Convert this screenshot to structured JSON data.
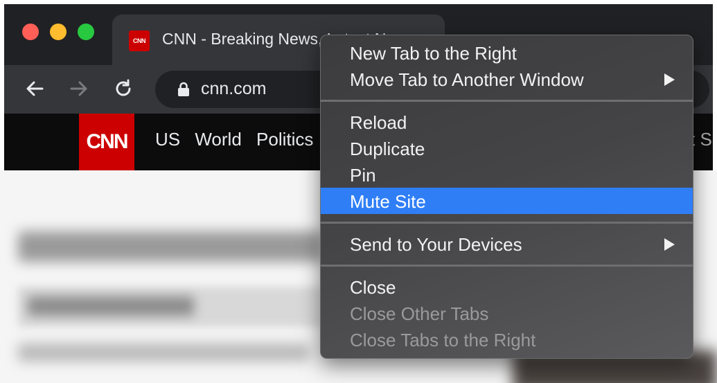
{
  "tab": {
    "favicon_text": "CNN",
    "title": "CNN - Breaking News, Latest News"
  },
  "toolbar": {
    "url": "cnn.com"
  },
  "site": {
    "logo": "CNN",
    "nav": [
      "US",
      "World",
      "Politics"
    ],
    "nav_right": "t S"
  },
  "menu": {
    "new_tab_right": "New Tab to the Right",
    "move_tab": "Move Tab to Another Window",
    "reload": "Reload",
    "duplicate": "Duplicate",
    "pin": "Pin",
    "mute_site": "Mute Site",
    "send_devices": "Send to Your Devices",
    "close": "Close",
    "close_other": "Close Other Tabs",
    "close_right": "Close Tabs to the Right"
  },
  "colors": {
    "highlight": "#2f7ef6",
    "cnn_red": "#cc0000"
  }
}
